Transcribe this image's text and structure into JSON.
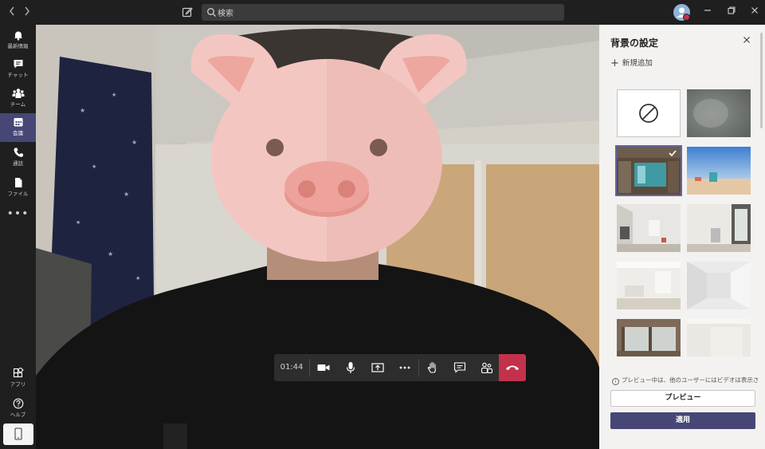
{
  "topbar": {
    "back_icon": "chevron-left-icon",
    "forward_icon": "chevron-right-icon",
    "search_placeholder": "検索",
    "window_controls": [
      "minimize-icon",
      "restore-icon",
      "close-icon"
    ]
  },
  "rail": {
    "items": [
      {
        "label": "最新情報",
        "icon": "bell-icon"
      },
      {
        "label": "チャット",
        "icon": "chat-icon"
      },
      {
        "label": "チーム",
        "icon": "teams-icon"
      },
      {
        "label": "会議",
        "icon": "calendar-icon",
        "active": true
      },
      {
        "label": "通話",
        "icon": "phone-icon"
      },
      {
        "label": "ファイル",
        "icon": "file-icon"
      }
    ],
    "more": "•••",
    "bottom": [
      {
        "label": "アプリ",
        "icon": "apps-icon"
      },
      {
        "label": "ヘルプ",
        "icon": "help-icon"
      }
    ]
  },
  "call": {
    "timer": "01:44",
    "controls": [
      "camera-icon",
      "mic-icon",
      "share-screen-icon",
      "more-icon",
      "raise-hand-icon",
      "chat-icon",
      "participants-icon",
      "hangup-icon"
    ]
  },
  "panel": {
    "title": "背景の設定",
    "add_new": "新規追加",
    "notice": "プレビュー中は、他のユーザーにはビデオは表示されま...",
    "preview_button": "プレビュー",
    "apply_button": "適用",
    "selected_index": 2
  },
  "colors": {
    "accent": "#464775",
    "selected_outline": "#6264a7",
    "hangup": "#c4314b",
    "pig": "#f3c6c2"
  }
}
